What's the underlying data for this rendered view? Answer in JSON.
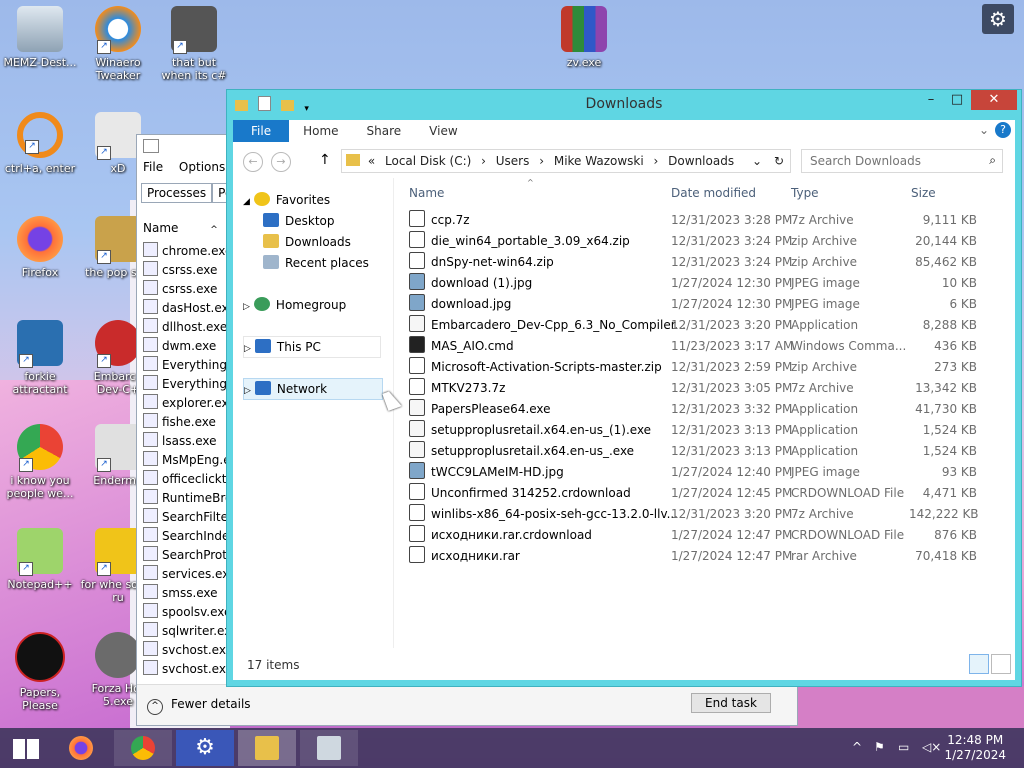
{
  "desktop": {
    "icons": [
      {
        "label": "MEMZ-Dest..."
      },
      {
        "label": "Winaero Tweaker"
      },
      {
        "label": "that but when its c#"
      },
      {
        "label": "zv.exe"
      },
      {
        "label": "ctrl+a, enter"
      },
      {
        "label": "xD"
      },
      {
        "label": "Firefox"
      },
      {
        "label": "the pop shit"
      },
      {
        "label": "forkie attractant"
      },
      {
        "label": "Embarca Dev-C+"
      },
      {
        "label": "i know you people we..."
      },
      {
        "label": "Enderma"
      },
      {
        "label": "Notepad++"
      },
      {
        "label": "for whe some ru"
      },
      {
        "label": "Papers, Please"
      },
      {
        "label": "Forza Hor 5.exe"
      }
    ]
  },
  "taskmgr": {
    "menu": [
      "File",
      "Options"
    ],
    "tabs": [
      "Processes",
      "Pe"
    ],
    "col_name": "Name",
    "processes": [
      "chrome.exe",
      "csrss.exe",
      "csrss.exe",
      "dasHost.exe",
      "dllhost.exe",
      "dwm.exe",
      "Everything.e",
      "Everything.e",
      "explorer.exe",
      "fishe.exe",
      "lsass.exe",
      "MsMpEng.e",
      "officeclickto",
      "RuntimeBro",
      "SearchFilterI",
      "SearchIndex",
      "SearchProto",
      "services.exe",
      "smss.exe",
      "spoolsv.exe",
      "sqlwriter.exe",
      "svchost.exe",
      "svchost.exe"
    ],
    "fewer_details": "Fewer details",
    "end_task": "End task"
  },
  "explorer": {
    "title": "Downloads",
    "ribbon_tabs": [
      "File",
      "Home",
      "Share",
      "View"
    ],
    "address": {
      "prefix": "«",
      "parts": [
        "Local Disk (C:)",
        "Users",
        "Mike Wazowski",
        "Downloads"
      ]
    },
    "search_placeholder": "Search Downloads",
    "nav": {
      "favorites": "Favorites",
      "desktop": "Desktop",
      "downloads": "Downloads",
      "recent": "Recent places",
      "homegroup": "Homegroup",
      "thispc": "This PC",
      "network": "Network"
    },
    "columns": {
      "name": "Name",
      "date": "Date modified",
      "type": "Type",
      "size": "Size"
    },
    "files": [
      {
        "name": "ccp.7z",
        "date": "12/31/2023 3:28 PM",
        "type": "7z Archive",
        "size": "9,111 KB"
      },
      {
        "name": "die_win64_portable_3.09_x64.zip",
        "date": "12/31/2023 3:24 PM",
        "type": "zip Archive",
        "size": "20,144 KB"
      },
      {
        "name": "dnSpy-net-win64.zip",
        "date": "12/31/2023 3:24 PM",
        "type": "zip Archive",
        "size": "85,462 KB"
      },
      {
        "name": "download (1).jpg",
        "date": "1/27/2024 12:30 PM",
        "type": "JPEG image",
        "size": "10 KB"
      },
      {
        "name": "download.jpg",
        "date": "1/27/2024 12:30 PM",
        "type": "JPEG image",
        "size": "6 KB"
      },
      {
        "name": "Embarcadero_Dev-Cpp_6.3_No_Compiler...",
        "date": "12/31/2023 3:20 PM",
        "type": "Application",
        "size": "8,288 KB"
      },
      {
        "name": "MAS_AIO.cmd",
        "date": "11/23/2023 3:17 AM",
        "type": "Windows Comma...",
        "size": "436 KB"
      },
      {
        "name": "Microsoft-Activation-Scripts-master.zip",
        "date": "12/31/2023 2:59 PM",
        "type": "zip Archive",
        "size": "273 KB"
      },
      {
        "name": "MTKV273.7z",
        "date": "12/31/2023 3:05 PM",
        "type": "7z Archive",
        "size": "13,342 KB"
      },
      {
        "name": "PapersPlease64.exe",
        "date": "12/31/2023 3:32 PM",
        "type": "Application",
        "size": "41,730 KB"
      },
      {
        "name": "setupproplusretail.x64.en-us_(1).exe",
        "date": "12/31/2023 3:13 PM",
        "type": "Application",
        "size": "1,524 KB"
      },
      {
        "name": "setupproplusretail.x64.en-us_.exe",
        "date": "12/31/2023 3:13 PM",
        "type": "Application",
        "size": "1,524 KB"
      },
      {
        "name": "tWCC9LAMeIM-HD.jpg",
        "date": "1/27/2024 12:40 PM",
        "type": "JPEG image",
        "size": "93 KB"
      },
      {
        "name": "Unconfirmed 314252.crdownload",
        "date": "1/27/2024 12:45 PM",
        "type": "CRDOWNLOAD File",
        "size": "4,471 KB"
      },
      {
        "name": "winlibs-x86_64-posix-seh-gcc-13.2.0-llv...",
        "date": "12/31/2023 3:20 PM",
        "type": "7z Archive",
        "size": "142,222 KB"
      },
      {
        "name": "исходники.rar.crdownload",
        "date": "1/27/2024 12:47 PM",
        "type": "CRDOWNLOAD File",
        "size": "876 KB"
      },
      {
        "name": "исходники.rar",
        "date": "1/27/2024 12:47 PM",
        "type": "rar Archive",
        "size": "70,418 KB"
      }
    ],
    "status": "17 items"
  },
  "taskbar": {
    "time": "12:48 PM",
    "date": "1/27/2024"
  },
  "colors": {
    "explorer_frame": "#5fd6e3",
    "file_tab": "#1979ca",
    "close": "#c7453a"
  }
}
